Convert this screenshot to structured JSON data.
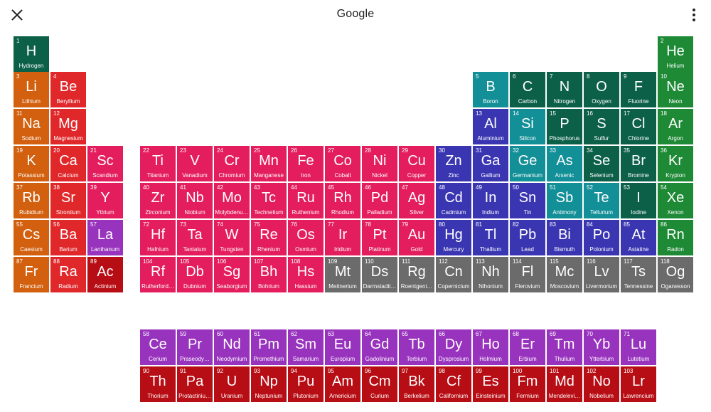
{
  "header": {
    "title": "Google",
    "close_icon": "close-icon",
    "menu_icon": "more-vert-icon"
  },
  "colors": {
    "alkali": "#d2600f",
    "alkaline": "#e0282b",
    "transition": "#e41e5e",
    "post_transition": "#3a36b2",
    "metalloid": "#138f98",
    "nonmetal": "#0d6048",
    "noble": "#1f8a36",
    "unknown": "#6b6b6b",
    "lanthanide": "#9833bd",
    "actinide": "#b70d14"
  },
  "elements": [
    {
      "n": "1",
      "s": "H",
      "name": "Hydrogen",
      "g": "nonmetal"
    },
    {
      "n": "2",
      "s": "He",
      "name": "Helium",
      "g": "noble"
    },
    {
      "n": "3",
      "s": "Li",
      "name": "Lithium",
      "g": "alkali"
    },
    {
      "n": "4",
      "s": "Be",
      "name": "Beryllium",
      "g": "alkaline"
    },
    {
      "n": "5",
      "s": "B",
      "name": "Boron",
      "g": "metalloid"
    },
    {
      "n": "6",
      "s": "C",
      "name": "Carbon",
      "g": "nonmetal"
    },
    {
      "n": "7",
      "s": "N",
      "name": "Nitrogen",
      "g": "nonmetal"
    },
    {
      "n": "8",
      "s": "O",
      "name": "Oxygen",
      "g": "nonmetal"
    },
    {
      "n": "9",
      "s": "F",
      "name": "Fluorine",
      "g": "nonmetal"
    },
    {
      "n": "10",
      "s": "Ne",
      "name": "Neon",
      "g": "noble"
    },
    {
      "n": "11",
      "s": "Na",
      "name": "Sodium",
      "g": "alkali"
    },
    {
      "n": "12",
      "s": "Mg",
      "name": "Magnesium",
      "g": "alkaline"
    },
    {
      "n": "13",
      "s": "Al",
      "name": "Aluminium",
      "g": "post_transition"
    },
    {
      "n": "14",
      "s": "Si",
      "name": "Silicon",
      "g": "metalloid"
    },
    {
      "n": "15",
      "s": "P",
      "name": "Phosphorus",
      "g": "nonmetal"
    },
    {
      "n": "16",
      "s": "S",
      "name": "Sulfur",
      "g": "nonmetal"
    },
    {
      "n": "17",
      "s": "Cl",
      "name": "Chlorine",
      "g": "nonmetal"
    },
    {
      "n": "18",
      "s": "Ar",
      "name": "Argon",
      "g": "noble"
    },
    {
      "n": "19",
      "s": "K",
      "name": "Potassium",
      "g": "alkali"
    },
    {
      "n": "20",
      "s": "Ca",
      "name": "Calcium",
      "g": "alkaline"
    },
    {
      "n": "21",
      "s": "Sc",
      "name": "Scandium",
      "g": "transition"
    },
    {
      "n": "22",
      "s": "Ti",
      "name": "Titanium",
      "g": "transition"
    },
    {
      "n": "23",
      "s": "V",
      "name": "Vanadium",
      "g": "transition"
    },
    {
      "n": "24",
      "s": "Cr",
      "name": "Chromium",
      "g": "transition"
    },
    {
      "n": "25",
      "s": "Mn",
      "name": "Manganese",
      "g": "transition"
    },
    {
      "n": "26",
      "s": "Fe",
      "name": "Iron",
      "g": "transition"
    },
    {
      "n": "27",
      "s": "Co",
      "name": "Cobalt",
      "g": "transition"
    },
    {
      "n": "28",
      "s": "Ni",
      "name": "Nickel",
      "g": "transition"
    },
    {
      "n": "29",
      "s": "Cu",
      "name": "Copper",
      "g": "transition"
    },
    {
      "n": "30",
      "s": "Zn",
      "name": "Zinc",
      "g": "post_transition"
    },
    {
      "n": "31",
      "s": "Ga",
      "name": "Gallium",
      "g": "post_transition"
    },
    {
      "n": "32",
      "s": "Ge",
      "name": "Germanium",
      "g": "metalloid"
    },
    {
      "n": "33",
      "s": "As",
      "name": "Arsenic",
      "g": "metalloid"
    },
    {
      "n": "34",
      "s": "Se",
      "name": "Selenium",
      "g": "nonmetal"
    },
    {
      "n": "35",
      "s": "Br",
      "name": "Bromine",
      "g": "nonmetal"
    },
    {
      "n": "36",
      "s": "Kr",
      "name": "Krypton",
      "g": "noble"
    },
    {
      "n": "37",
      "s": "Rb",
      "name": "Rubidium",
      "g": "alkali"
    },
    {
      "n": "38",
      "s": "Sr",
      "name": "Strontium",
      "g": "alkaline"
    },
    {
      "n": "39",
      "s": "Y",
      "name": "Yttrium",
      "g": "transition"
    },
    {
      "n": "40",
      "s": "Zr",
      "name": "Zirconium",
      "g": "transition"
    },
    {
      "n": "41",
      "s": "Nb",
      "name": "Niobium",
      "g": "transition"
    },
    {
      "n": "42",
      "s": "Mo",
      "name": "Molybdenu…",
      "g": "transition"
    },
    {
      "n": "43",
      "s": "Tc",
      "name": "Technetium",
      "g": "transition"
    },
    {
      "n": "44",
      "s": "Ru",
      "name": "Ruthenium",
      "g": "transition"
    },
    {
      "n": "45",
      "s": "Rh",
      "name": "Rhodium",
      "g": "transition"
    },
    {
      "n": "46",
      "s": "Pd",
      "name": "Palladium",
      "g": "transition"
    },
    {
      "n": "47",
      "s": "Ag",
      "name": "Silver",
      "g": "transition"
    },
    {
      "n": "48",
      "s": "Cd",
      "name": "Cadmium",
      "g": "post_transition"
    },
    {
      "n": "49",
      "s": "In",
      "name": "Indium",
      "g": "post_transition"
    },
    {
      "n": "50",
      "s": "Sn",
      "name": "Tin",
      "g": "post_transition"
    },
    {
      "n": "51",
      "s": "Sb",
      "name": "Antimony",
      "g": "metalloid"
    },
    {
      "n": "52",
      "s": "Te",
      "name": "Tellurium",
      "g": "metalloid"
    },
    {
      "n": "53",
      "s": "I",
      "name": "Iodine",
      "g": "nonmetal"
    },
    {
      "n": "54",
      "s": "Xe",
      "name": "Xenon",
      "g": "noble"
    },
    {
      "n": "55",
      "s": "Cs",
      "name": "Caesium",
      "g": "alkali"
    },
    {
      "n": "56",
      "s": "Ba",
      "name": "Barium",
      "g": "alkaline"
    },
    {
      "n": "57",
      "s": "La",
      "name": "Lanthanum",
      "g": "lanthanide"
    },
    {
      "n": "72",
      "s": "Hf",
      "name": "Hafnium",
      "g": "transition"
    },
    {
      "n": "73",
      "s": "Ta",
      "name": "Tantalum",
      "g": "transition"
    },
    {
      "n": "74",
      "s": "W",
      "name": "Tungsten",
      "g": "transition"
    },
    {
      "n": "75",
      "s": "Re",
      "name": "Rhenium",
      "g": "transition"
    },
    {
      "n": "76",
      "s": "Os",
      "name": "Osmium",
      "g": "transition"
    },
    {
      "n": "77",
      "s": "Ir",
      "name": "Iridium",
      "g": "transition"
    },
    {
      "n": "78",
      "s": "Pt",
      "name": "Platinum",
      "g": "transition"
    },
    {
      "n": "79",
      "s": "Au",
      "name": "Gold",
      "g": "transition"
    },
    {
      "n": "80",
      "s": "Hg",
      "name": "Mercury",
      "g": "post_transition"
    },
    {
      "n": "81",
      "s": "Tl",
      "name": "Thallium",
      "g": "post_transition"
    },
    {
      "n": "82",
      "s": "Pb",
      "name": "Lead",
      "g": "post_transition"
    },
    {
      "n": "83",
      "s": "Bi",
      "name": "Bismuth",
      "g": "post_transition"
    },
    {
      "n": "84",
      "s": "Po",
      "name": "Polonium",
      "g": "post_transition"
    },
    {
      "n": "85",
      "s": "At",
      "name": "Astatine",
      "g": "post_transition"
    },
    {
      "n": "86",
      "s": "Rn",
      "name": "Radon",
      "g": "noble"
    },
    {
      "n": "87",
      "s": "Fr",
      "name": "Francium",
      "g": "alkali"
    },
    {
      "n": "88",
      "s": "Ra",
      "name": "Radium",
      "g": "alkaline"
    },
    {
      "n": "89",
      "s": "Ac",
      "name": "Actinium",
      "g": "actinide"
    },
    {
      "n": "104",
      "s": "Rf",
      "name": "Rutherford…",
      "g": "transition"
    },
    {
      "n": "105",
      "s": "Db",
      "name": "Dubnium",
      "g": "transition"
    },
    {
      "n": "106",
      "s": "Sg",
      "name": "Seaborgium",
      "g": "transition"
    },
    {
      "n": "107",
      "s": "Bh",
      "name": "Bohrium",
      "g": "transition"
    },
    {
      "n": "108",
      "s": "Hs",
      "name": "Hassium",
      "g": "transition"
    },
    {
      "n": "109",
      "s": "Mt",
      "name": "Meitnerium",
      "g": "unknown"
    },
    {
      "n": "110",
      "s": "Ds",
      "name": "Darmstadti…",
      "g": "unknown"
    },
    {
      "n": "111",
      "s": "Rg",
      "name": "Roentgeni…",
      "g": "unknown"
    },
    {
      "n": "112",
      "s": "Cn",
      "name": "Copernicium",
      "g": "unknown"
    },
    {
      "n": "113",
      "s": "Nh",
      "name": "Nihonium",
      "g": "unknown"
    },
    {
      "n": "114",
      "s": "Fl",
      "name": "Flerovium",
      "g": "unknown"
    },
    {
      "n": "115",
      "s": "Mc",
      "name": "Moscovium",
      "g": "unknown"
    },
    {
      "n": "116",
      "s": "Lv",
      "name": "Livermorium",
      "g": "unknown"
    },
    {
      "n": "117",
      "s": "Ts",
      "name": "Tennessine",
      "g": "unknown"
    },
    {
      "n": "118",
      "s": "Og",
      "name": "Oganesson",
      "g": "unknown"
    },
    {
      "n": "58",
      "s": "Ce",
      "name": "Cerium",
      "g": "lanthanide"
    },
    {
      "n": "59",
      "s": "Pr",
      "name": "Praseody…",
      "g": "lanthanide"
    },
    {
      "n": "60",
      "s": "Nd",
      "name": "Neodymium",
      "g": "lanthanide"
    },
    {
      "n": "61",
      "s": "Pm",
      "name": "Promethium",
      "g": "lanthanide"
    },
    {
      "n": "62",
      "s": "Sm",
      "name": "Samarium",
      "g": "lanthanide"
    },
    {
      "n": "63",
      "s": "Eu",
      "name": "Europium",
      "g": "lanthanide"
    },
    {
      "n": "64",
      "s": "Gd",
      "name": "Gadolinium",
      "g": "lanthanide"
    },
    {
      "n": "65",
      "s": "Tb",
      "name": "Terbium",
      "g": "lanthanide"
    },
    {
      "n": "66",
      "s": "Dy",
      "name": "Dysprosium",
      "g": "lanthanide"
    },
    {
      "n": "67",
      "s": "Ho",
      "name": "Holmium",
      "g": "lanthanide"
    },
    {
      "n": "68",
      "s": "Er",
      "name": "Erbium",
      "g": "lanthanide"
    },
    {
      "n": "69",
      "s": "Tm",
      "name": "Thulium",
      "g": "lanthanide"
    },
    {
      "n": "70",
      "s": "Yb",
      "name": "Ytterbium",
      "g": "lanthanide"
    },
    {
      "n": "71",
      "s": "Lu",
      "name": "Lutetium",
      "g": "lanthanide"
    },
    {
      "n": "90",
      "s": "Th",
      "name": "Thorium",
      "g": "actinide"
    },
    {
      "n": "91",
      "s": "Pa",
      "name": "Protactiniu…",
      "g": "actinide"
    },
    {
      "n": "92",
      "s": "U",
      "name": "Uranium",
      "g": "actinide"
    },
    {
      "n": "93",
      "s": "Np",
      "name": "Neptunium",
      "g": "actinide"
    },
    {
      "n": "94",
      "s": "Pu",
      "name": "Plutonium",
      "g": "actinide"
    },
    {
      "n": "95",
      "s": "Am",
      "name": "Americium",
      "g": "actinide"
    },
    {
      "n": "96",
      "s": "Cm",
      "name": "Curium",
      "g": "actinide"
    },
    {
      "n": "97",
      "s": "Bk",
      "name": "Berkelium",
      "g": "actinide"
    },
    {
      "n": "98",
      "s": "Cf",
      "name": "Californium",
      "g": "actinide"
    },
    {
      "n": "99",
      "s": "Es",
      "name": "Einsteinium",
      "g": "actinide"
    },
    {
      "n": "100",
      "s": "Fm",
      "name": "Fermium",
      "g": "actinide"
    },
    {
      "n": "101",
      "s": "Md",
      "name": "Mendelevi…",
      "g": "actinide"
    },
    {
      "n": "102",
      "s": "No",
      "name": "Nobelium",
      "g": "actinide"
    },
    {
      "n": "103",
      "s": "Lr",
      "name": "Lawrencium",
      "g": "actinide"
    }
  ]
}
